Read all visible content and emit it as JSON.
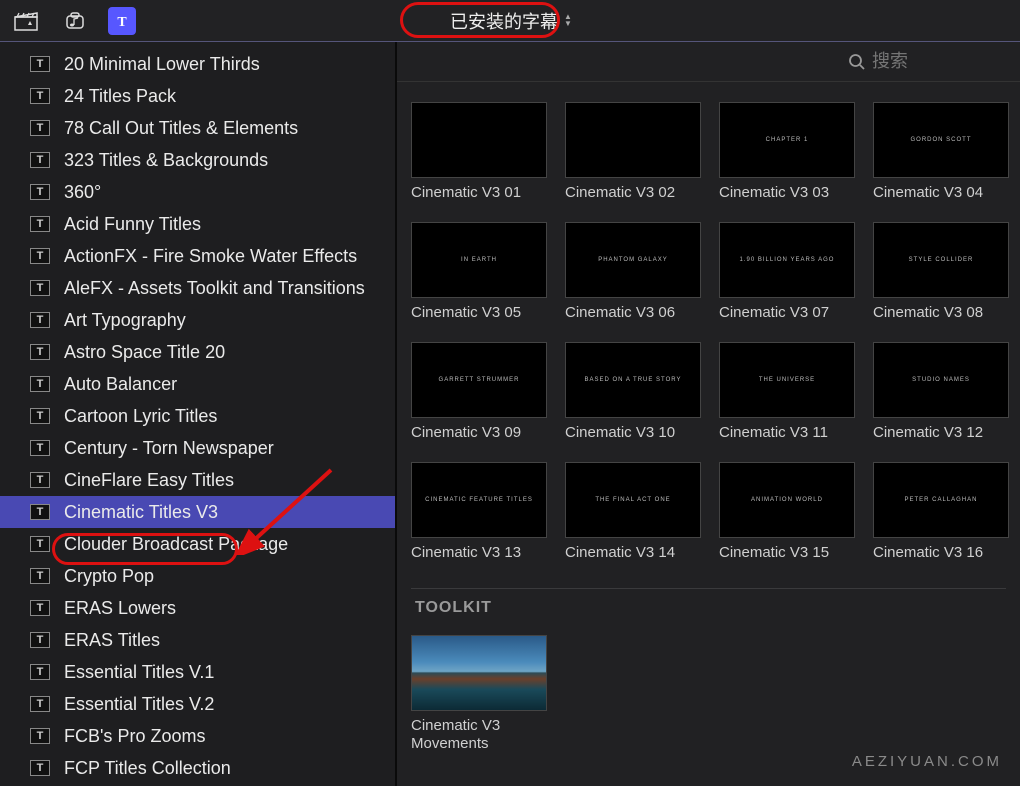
{
  "toolbar": {
    "dropdown_label": "已安装的字幕"
  },
  "search": {
    "placeholder": "搜索"
  },
  "watermark": "AEZIYUAN.COM",
  "sidebar": {
    "items": [
      "20 Minimal Lower Thirds",
      "24 Titles Pack",
      "78 Call Out Titles & Elements",
      "323 Titles & Backgrounds",
      "360°",
      "Acid Funny Titles",
      "ActionFX - Fire Smoke Water Effects",
      "AleFX - Assets Toolkit and Transitions",
      "Art Typography",
      "Astro Space Title 20",
      "Auto Balancer",
      "Cartoon Lyric Titles",
      "Century - Torn Newspaper",
      "CineFlare Easy Titles",
      "Cinematic Titles V3",
      "Clouder Broadcast Package",
      "Crypto Pop",
      "ERAS Lowers",
      "ERAS Titles",
      "Essential Titles V.1",
      "Essential Titles V.2",
      "FCB's Pro Zooms",
      "FCP Titles Collection"
    ],
    "selected": 14
  },
  "content": {
    "items": [
      {
        "label": "Cinematic V3 01",
        "thumb_text": ""
      },
      {
        "label": "Cinematic V3 02",
        "thumb_text": ""
      },
      {
        "label": "Cinematic V3 03",
        "thumb_text": "CHAPTER 1"
      },
      {
        "label": "Cinematic V3 04",
        "thumb_text": "GORDON SCOTT"
      },
      {
        "label": "Cinematic V3 05",
        "thumb_text": "IN EARTH"
      },
      {
        "label": "Cinematic V3 06",
        "thumb_text": "PHANTOM GALAXY"
      },
      {
        "label": "Cinematic V3 07",
        "thumb_text": "1.90 BILLION YEARS AGO"
      },
      {
        "label": "Cinematic V3 08",
        "thumb_text": "STYLE COLLIDER"
      },
      {
        "label": "Cinematic V3 09",
        "thumb_text": "GARRETT STRUMMER"
      },
      {
        "label": "Cinematic V3 10",
        "thumb_text": "BASED ON A TRUE STORY"
      },
      {
        "label": "Cinematic V3 11",
        "thumb_text": "THE UNIVERSE"
      },
      {
        "label": "Cinematic V3 12",
        "thumb_text": "STUDIO NAMES"
      },
      {
        "label": "Cinematic V3 13",
        "thumb_text": "CINEMATIC FEATURE TITLES"
      },
      {
        "label": "Cinematic V3 14",
        "thumb_text": "THE FINAL ACT ONE"
      },
      {
        "label": "Cinematic V3 15",
        "thumb_text": "ANIMATION WORLD"
      },
      {
        "label": "Cinematic V3 16",
        "thumb_text": "PETER CALLAGHAN"
      }
    ],
    "section_header": "TOOLKIT",
    "toolkit_items": [
      {
        "label": "Cinematic V3 Movements",
        "image": true
      }
    ]
  }
}
